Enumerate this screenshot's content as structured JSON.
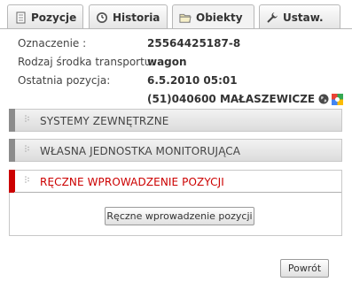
{
  "tabs": [
    {
      "label": "Pozycje",
      "icon": "document-icon"
    },
    {
      "label": "Historia",
      "icon": "clock-icon"
    },
    {
      "label": "Obiekty",
      "icon": "folder-icon"
    },
    {
      "label": "Ustaw.",
      "icon": "wrench-icon"
    }
  ],
  "info": {
    "designation_label": "Oznaczenie :",
    "designation_value": "25564425187-8",
    "transport_label": "Rodzaj środka transportu:",
    "transport_value": "wagon",
    "last_position_label": "Ostatnia pozycja:",
    "last_position_date": "6.5.2010 05:01",
    "last_position_location": "(51)040600 MAŁASZEWICZE"
  },
  "sections": [
    {
      "title": "SYSTEMY ZEWNĘTRZNE"
    },
    {
      "title": "WŁASNA JEDNOSTKA MONITORUJĄCA"
    },
    {
      "title": "RĘCZNE WPROWADZENIE POZYCJI"
    }
  ],
  "buttons": {
    "manual_entry": "Ręczne wprowadzenie pozycji",
    "back": "Powrót"
  },
  "colors": {
    "accent": "#cc0000",
    "section_bar": "#8c8c8c"
  }
}
